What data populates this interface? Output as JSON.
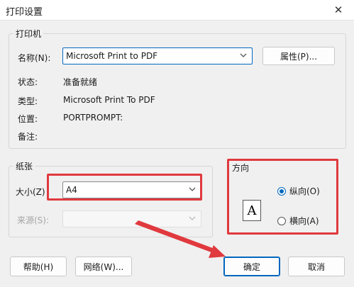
{
  "window": {
    "title": "打印设置",
    "close_glyph": "✕"
  },
  "printer": {
    "group_label": "打印机",
    "name_label": "名称(N):",
    "name_value": "Microsoft Print to PDF",
    "properties_button": "属性(P)...",
    "status_label": "状态:",
    "status_value": "准备就绪",
    "type_label": "类型:",
    "type_value": "Microsoft Print To PDF",
    "location_label": "位置:",
    "location_value": "PORTPROMPT:",
    "comment_label": "备注:"
  },
  "paper": {
    "group_label": "纸张",
    "size_label": "大小(Z)",
    "size_value": "A4",
    "source_label": "来源(S):",
    "source_value": ""
  },
  "orientation": {
    "group_label": "方向",
    "page_glyph": "A",
    "portrait_label": "纵向(O)",
    "landscape_label": "横向(A)",
    "selected": "portrait"
  },
  "buttons": {
    "help": "帮助(H)",
    "network": "网络(W)...",
    "ok": "确定",
    "cancel": "取消"
  },
  "colors": {
    "accent": "#0067c0",
    "annotation": "#e0393e"
  },
  "icons": {
    "close": "close-icon",
    "dropdown": "chevron-down-icon",
    "page_preview": "portrait-page-icon"
  }
}
